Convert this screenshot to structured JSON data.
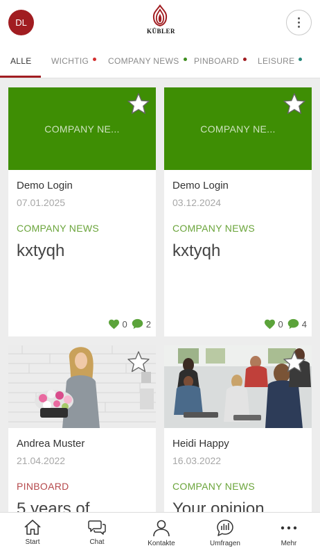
{
  "header": {
    "avatar_initials": "DL",
    "logo_text": "KÜBLER",
    "brand_color": "#a11d21"
  },
  "tabs": [
    {
      "label": "ALLE",
      "active": true,
      "dot_color": null
    },
    {
      "label": "WICHTIG",
      "active": false,
      "dot_color": "#d32f2f"
    },
    {
      "label": "COMPANY NEWS",
      "active": false,
      "dot_color": "#3e8e1f"
    },
    {
      "label": "PINBOARD",
      "active": false,
      "dot_color": "#a11d21"
    },
    {
      "label": "LEISURE",
      "active": false,
      "dot_color": "#26867a"
    }
  ],
  "cards": [
    {
      "placeholder": "COMPANY NE...",
      "author": "Demo Login",
      "date": "07.01.2025",
      "category": "COMPANY NEWS",
      "category_color": "#6aa43a",
      "title": "kxtyqh",
      "likes": "0",
      "comments": "2"
    },
    {
      "placeholder": "COMPANY NE...",
      "author": "Demo Login",
      "date": "03.12.2024",
      "category": "COMPANY NEWS",
      "category_color": "#6aa43a",
      "title": "kxtyqh",
      "likes": "0",
      "comments": "4"
    },
    {
      "author": "Andrea Muster",
      "date": "21.04.2022",
      "category": "PINBOARD",
      "category_color": "#b5484b",
      "title": "5 years of"
    },
    {
      "author": "Heidi Happy",
      "date": "16.03.2022",
      "category": "COMPANY NEWS",
      "category_color": "#6aa43a",
      "title": "Your opinion"
    }
  ],
  "bottom_nav": [
    {
      "label": "Start",
      "icon": "home-icon"
    },
    {
      "label": "Chat",
      "icon": "chat-icon"
    },
    {
      "label": "Kontakte",
      "icon": "person-icon"
    },
    {
      "label": "Umfragen",
      "icon": "poll-icon"
    },
    {
      "label": "Mehr",
      "icon": "more-dots-icon"
    }
  ]
}
